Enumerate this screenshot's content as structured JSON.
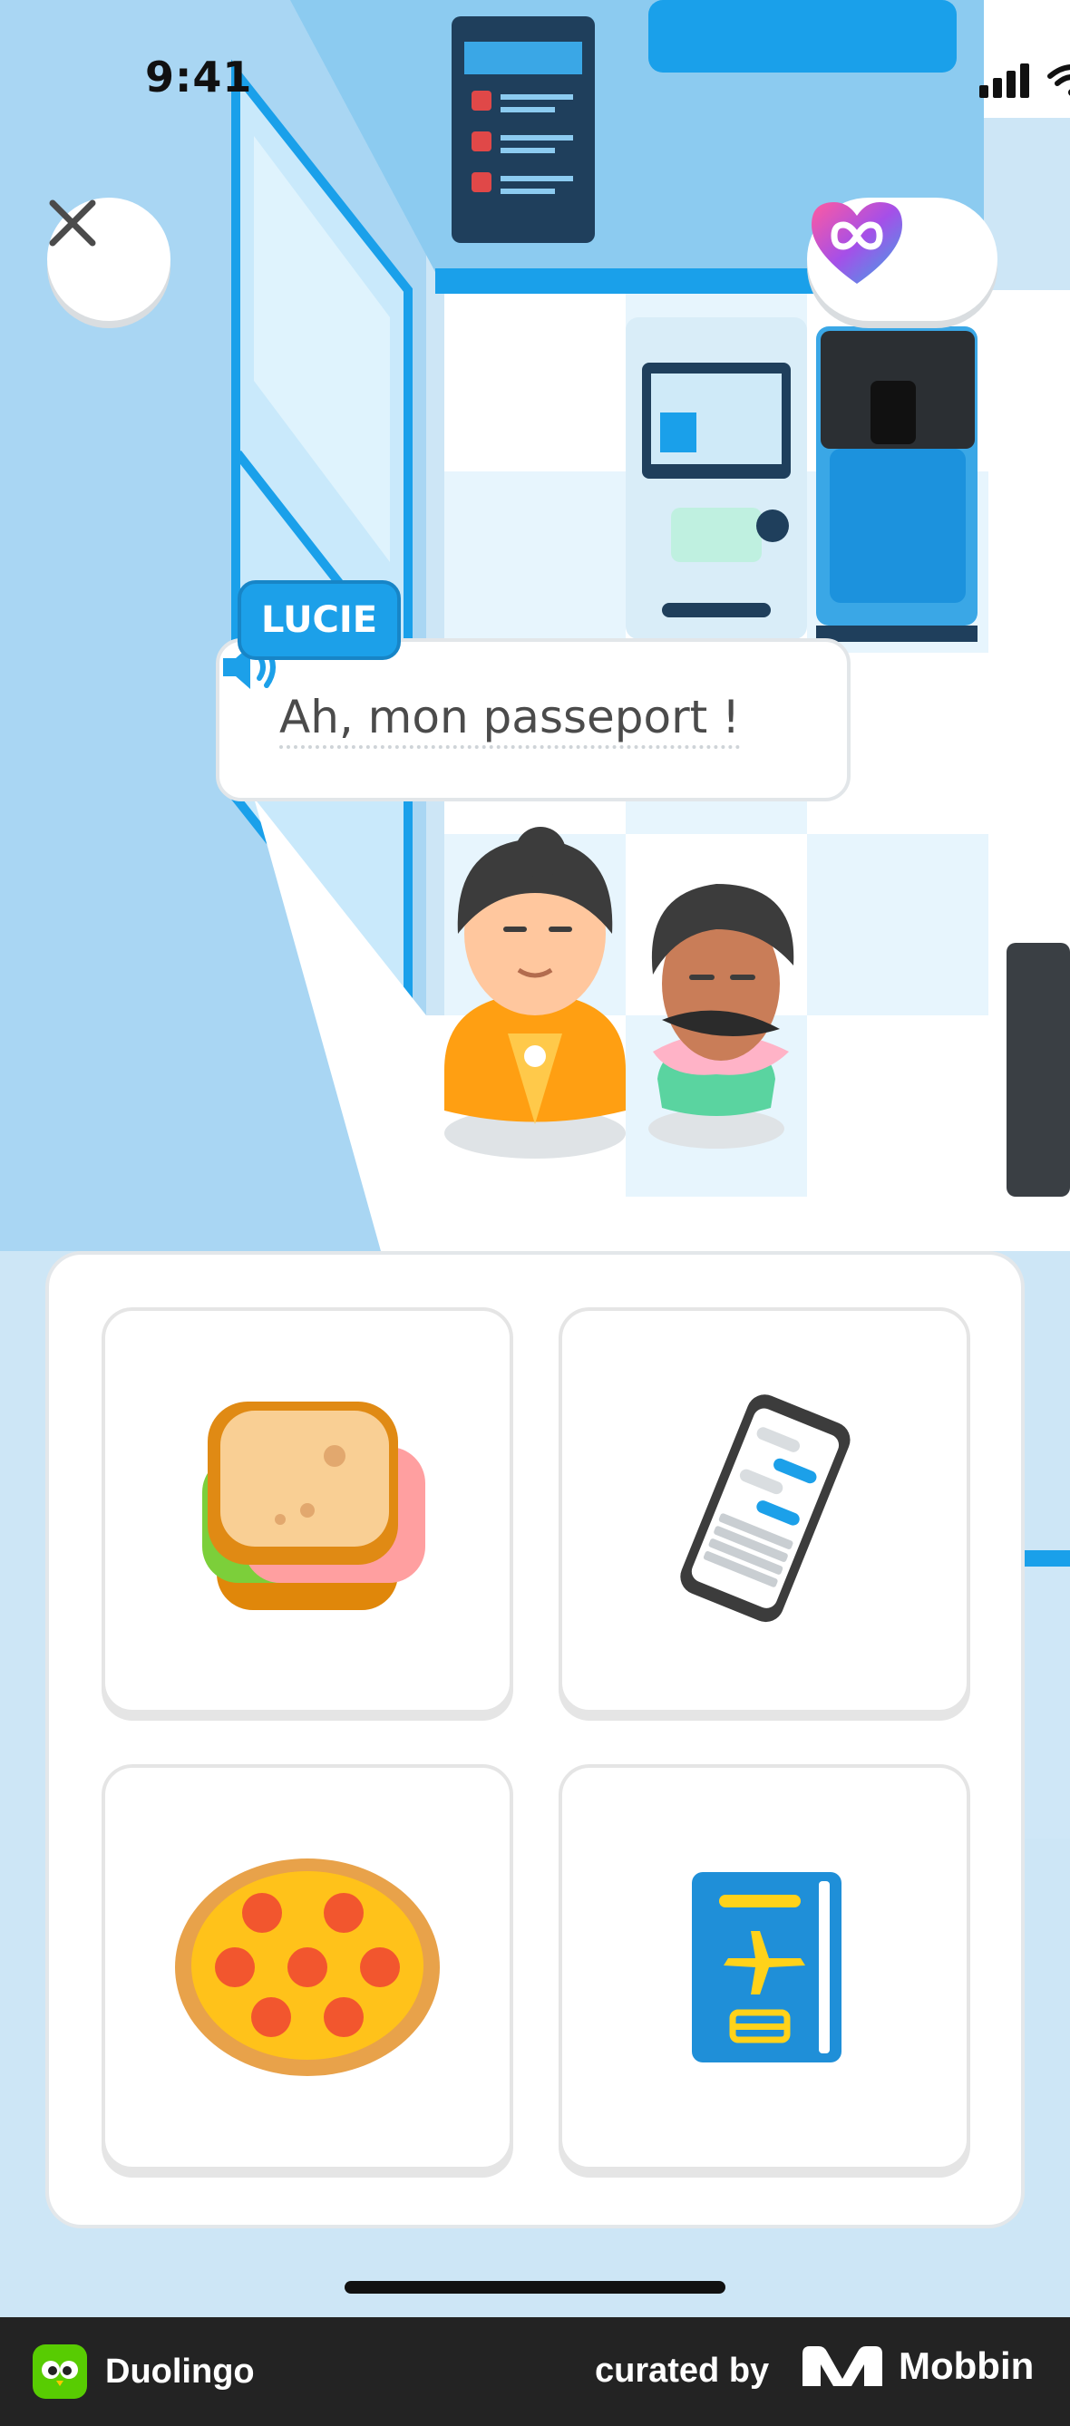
{
  "status_bar": {
    "time": "9:41"
  },
  "dialogue": {
    "speaker": "LUCIE",
    "line": "Ah, mon passeport !"
  },
  "choices": [
    {
      "item": "sandwich"
    },
    {
      "item": "phone"
    },
    {
      "item": "pizza"
    },
    {
      "item": "passport"
    }
  ],
  "footer": {
    "app_name": "Duolingo",
    "curated_by": "curated by",
    "brand": "Mobbin"
  },
  "colors": {
    "accent": "#1ca0e9",
    "wall": "#8fcbf0",
    "floor": "#ffffff"
  }
}
